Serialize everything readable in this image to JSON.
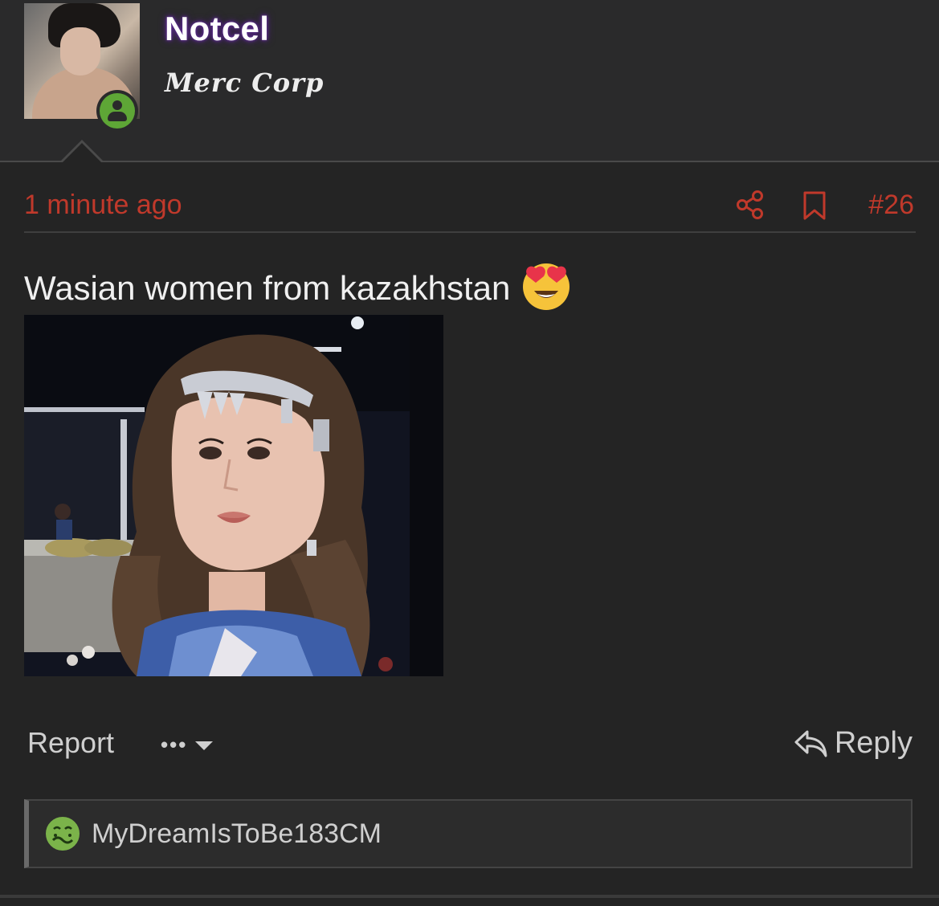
{
  "post": {
    "author": {
      "username": "Notcel",
      "user_title": "Merc Corp",
      "status": "online"
    },
    "meta": {
      "timestamp": "1 minute ago",
      "post_number": "#26"
    },
    "body": {
      "text": "Wasian women from kazakhstan",
      "emoji": "heart-eyes"
    },
    "actions": {
      "report_label": "Report",
      "more_label": "•••",
      "reply_label": "Reply"
    },
    "reactions": {
      "reactor": "MyDreamIsToBe183CM",
      "reaction_icon": "nauseated-face"
    }
  },
  "colors": {
    "background": "#242424",
    "accent_red": "#c0392b",
    "username_glow": "#5b2a8c",
    "online_green": "#5ea636"
  }
}
